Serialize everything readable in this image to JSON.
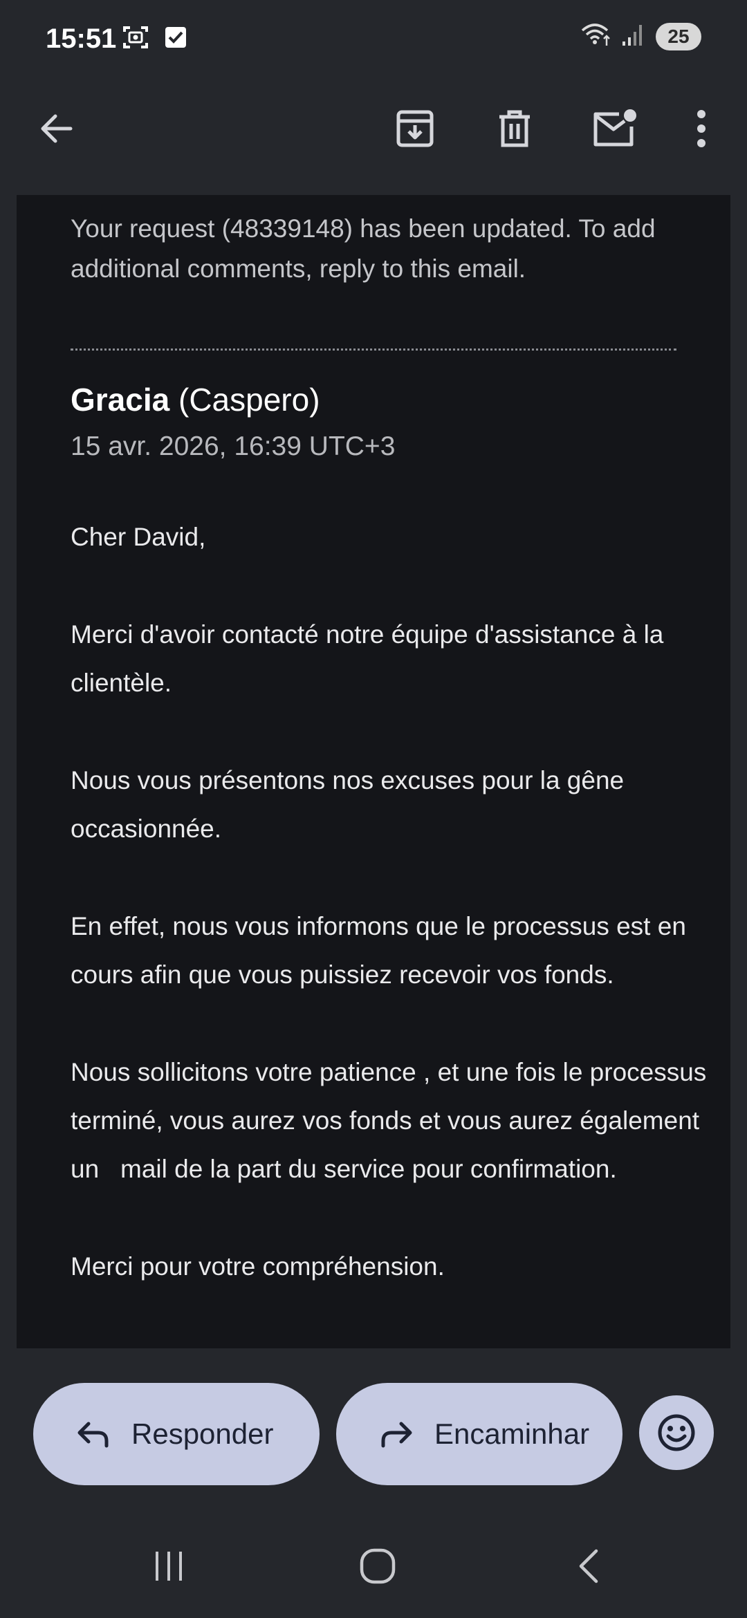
{
  "status_bar": {
    "time": "15:51",
    "battery": "25",
    "left_icons": [
      "screenshot-icon",
      "checkbox-icon"
    ],
    "right_icons": [
      "wifi-icon",
      "signal-icon"
    ]
  },
  "toolbar": {
    "icons": [
      "back-arrow-icon",
      "archive-icon",
      "delete-icon",
      "mark-unread-icon",
      "more-vert-icon"
    ]
  },
  "email": {
    "intro": "Your request (48339148) has been updated. To add additional comments, reply to this email.",
    "sender_name": "Gracia",
    "sender_org": "(Caspero)",
    "date": "15 avr. 2026, 16:39 UTC+3",
    "paragraphs": [
      "Cher David,",
      "Merci d'avoir contacté notre équipe d'assistance à la clientèle.",
      "Nous vous présentons nos excuses pour la gêne occasionnée.",
      "En effet, nous vous informons que le processus est en cours afin que vous puissiez recevoir vos fonds.",
      "Nous sollicitons votre patience , et une fois le processus terminé, vous aurez vos fonds et vous aurez également un   mail de la part du service pour confirmation.",
      "Merci pour votre compréhension."
    ]
  },
  "actions": {
    "reply_label": "Responder",
    "forward_label": "Encaminhar"
  },
  "colors": {
    "background": "#25272c",
    "card": "#141519",
    "pill": "#c6cbe3"
  }
}
